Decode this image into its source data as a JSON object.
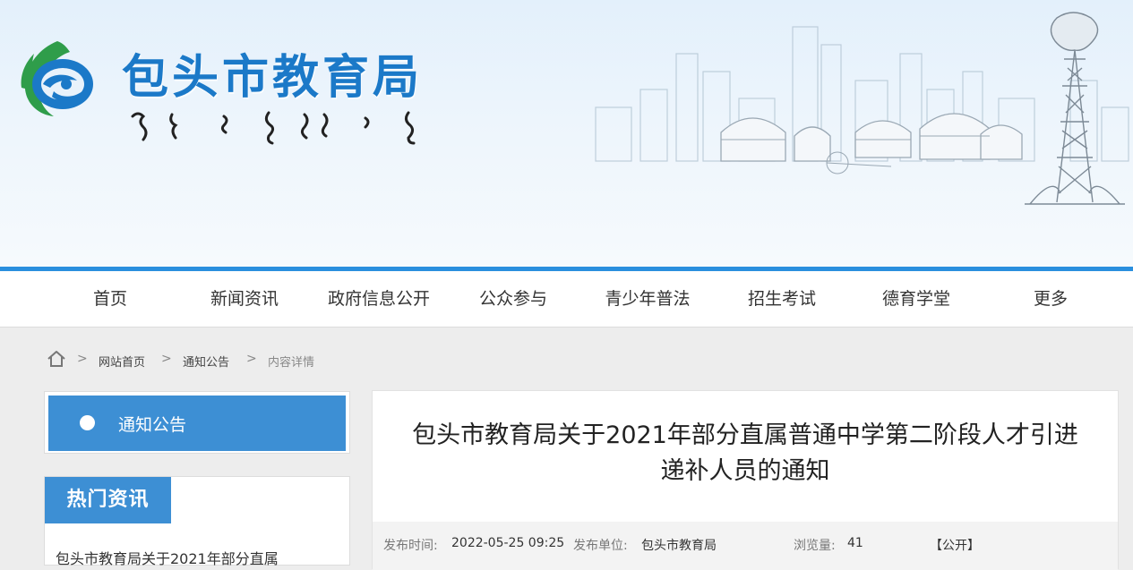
{
  "header": {
    "site_title": "包头市教育局",
    "colors": {
      "brand_blue": "#1b79c8",
      "accent_green": "#2f9d4a",
      "banner_line": "#2a8fde"
    }
  },
  "nav": {
    "items": [
      "首页",
      "新闻资讯",
      "政府信息公开",
      "公众参与",
      "青少年普法",
      "招生考试",
      "德育学堂",
      "更多"
    ]
  },
  "breadcrumb": {
    "home_icon": "home-icon",
    "separator": ">",
    "items": [
      "网站首页",
      "通知公告",
      "内容详情"
    ]
  },
  "sidebar": {
    "active_item": "通知公告",
    "hot_title": "热门资讯",
    "hot_items": [
      "包头市教育局关于2021年部分直属"
    ]
  },
  "article": {
    "title_line1": "包头市教育局关于2021年部分直属普通中学第二阶段人才引进",
    "title_line2": "递补人员的通知",
    "meta": {
      "publish_time_label": "发布时间:",
      "publish_time": "2022-05-25 09:25",
      "publisher_label": "发布单位:",
      "publisher": "包头市教育局",
      "views_label": "浏览量:",
      "views": "41",
      "visibility": "【公开】"
    }
  }
}
